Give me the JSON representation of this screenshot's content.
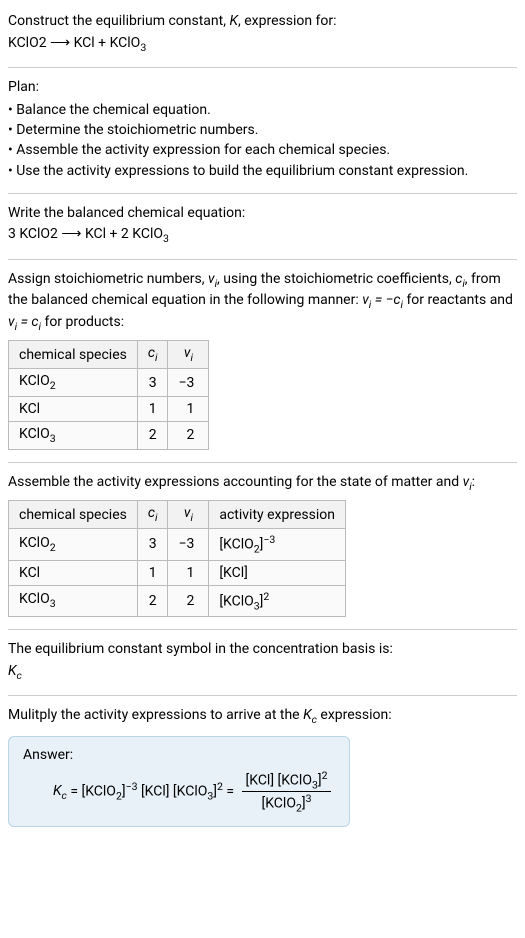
{
  "intro": {
    "line1_pre": "Construct the equilibrium constant, ",
    "line1_post": ", expression for:",
    "reaction": "KClO2  ⟶  KCl + KClO"
  },
  "plan": {
    "title": "Plan:",
    "items": [
      "Balance the chemical equation.",
      "Determine the stoichiometric numbers.",
      "Assemble the activity expression for each chemical species.",
      "Use the activity expressions to build the equilibrium constant expression."
    ]
  },
  "balanced": {
    "intro": "Write the balanced chemical equation:",
    "reaction": "3 KClO2  ⟶  KCl + 2 KClO"
  },
  "assign": {
    "text_a": "Assign stoichiometric numbers, ",
    "text_b": ", using the stoichiometric coefficients, ",
    "text_c": ", from the balanced chemical equation in the following manner: ",
    "text_d": " for reactants and ",
    "text_e": " for products:"
  },
  "table1": {
    "headers": {
      "species": "chemical species",
      "ci": "c",
      "vi": "ν"
    },
    "rows": [
      {
        "sp": "KClO2",
        "c": "3",
        "v": "−3",
        "sub": "2"
      },
      {
        "sp": "KCl",
        "c": "1",
        "v": "1",
        "sub": ""
      },
      {
        "sp": "KClO3",
        "c": "2",
        "v": "2",
        "sub": "3"
      }
    ]
  },
  "assemble": {
    "text_a": "Assemble the activity expressions accounting for the state of matter and "
  },
  "table2": {
    "headers": {
      "species": "chemical species",
      "ci": "c",
      "vi": "ν",
      "ae": "activity expression"
    },
    "rows": [
      {
        "sp": "KClO2",
        "sub": "2",
        "c": "3",
        "v": "−3",
        "ae_base": "[KClO",
        "ae_sub": "2",
        "ae_close": "]",
        "ae_sup": "−3"
      },
      {
        "sp": "KCl",
        "sub": "",
        "c": "1",
        "v": "1",
        "ae_base": "[KCl",
        "ae_sub": "",
        "ae_close": "]",
        "ae_sup": ""
      },
      {
        "sp": "KClO3",
        "sub": "3",
        "c": "2",
        "v": "2",
        "ae_base": "[KClO",
        "ae_sub": "3",
        "ae_close": "]",
        "ae_sup": "2"
      }
    ]
  },
  "symbol": {
    "line": "The equilibrium constant symbol in the concentration basis is:"
  },
  "mult": {
    "line_a": "Mulitply the activity expressions to arrive at the ",
    "line_b": " expression:"
  },
  "answer": {
    "label": "Answer:"
  }
}
